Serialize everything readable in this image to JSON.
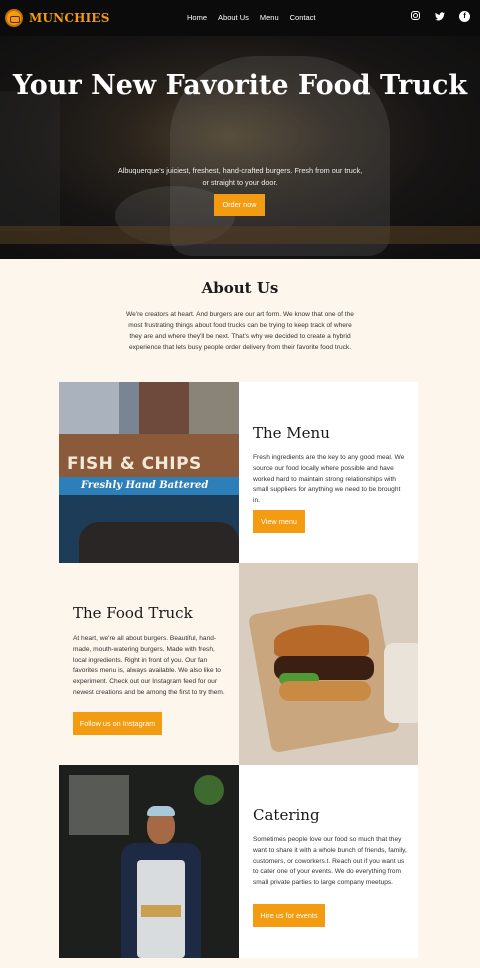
{
  "nav": {
    "brand": "MUNCHIES",
    "links": [
      "Home",
      "About Us",
      "Menu",
      "Contact"
    ],
    "social_icons": [
      "instagram-icon",
      "twitter-icon",
      "facebook-icon"
    ]
  },
  "hero": {
    "title": "Your New Favorite Food Truck",
    "subtitle": "Albuquerque's juiciest, freshest, hand-crafted burgers. Fresh from our truck, or straight to your door.",
    "button": "Order now"
  },
  "about": {
    "title": "About Us",
    "text": "We're creators at heart. And burgers are our art form. We know that one of the most frustrating things about food trucks can be trying to keep track of where they are and where they'll be next. That's why we decided to create a hybrid experience that lets busy people order delivery from their favorite food truck."
  },
  "menu": {
    "image_sign": "FISH & CHIPS",
    "image_band": "Freshly Hand Battered",
    "title": "The Menu",
    "text": "Fresh ingredients are the key to any good meal. We source our food locally where possible and have worked hard to maintain strong relationships with small suppliers for anything we need to be brought in.",
    "button": "View menu"
  },
  "truck": {
    "title": "The Food Truck",
    "text": "At heart, we're all about burgers. Beautiful, hand-made, mouth-watering burgers. Made with fresh, local ingredients. Right in front of you. Our fan favorites menu is, always available. We also like to experiment. Check out our Instagram feed for our newest creations and be among the first to try them.",
    "button": "Follow us on Instagram"
  },
  "catering": {
    "title": "Catering",
    "text": "Sometimes people love our food so much that they want to share it with a whole bunch of friends, family, customers, or coworkers.t. Reach out if you want us to cater one of your events. We do everything from small private parties to large company meetups.",
    "button": "Hire us for events"
  },
  "colors": {
    "accent": "#f39c12",
    "nav_bg": "#0b0b0b",
    "page_bg": "#fdf6ec"
  }
}
